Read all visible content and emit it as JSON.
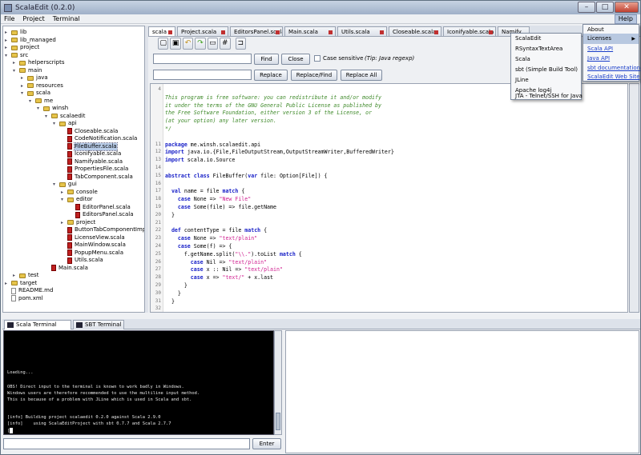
{
  "window": {
    "title": "ScalaEdit (0.2.0)"
  },
  "menubar": {
    "file": "File",
    "project": "Project",
    "terminal": "Terminal",
    "help": "Help"
  },
  "tree": [
    {
      "label": "lib",
      "kind": "folder"
    },
    {
      "label": "lib_managed",
      "kind": "folder"
    },
    {
      "label": "project",
      "kind": "folder"
    },
    {
      "label": "src",
      "kind": "folder"
    },
    {
      "label": "helperscripts",
      "kind": "folder"
    },
    {
      "label": "main",
      "kind": "folder"
    },
    {
      "label": "java",
      "kind": "folder"
    },
    {
      "label": "resources",
      "kind": "folder"
    },
    {
      "label": "scala",
      "kind": "folder"
    },
    {
      "label": "me",
      "kind": "folder"
    },
    {
      "label": "winsh",
      "kind": "folder"
    },
    {
      "label": "scalaedit",
      "kind": "folder"
    },
    {
      "label": "api",
      "kind": "folder"
    },
    {
      "label": "Closeable.scala",
      "kind": "scala"
    },
    {
      "label": "CodeNotification.scala",
      "kind": "scala"
    },
    {
      "label": "FileBuffer.scala",
      "kind": "scala"
    },
    {
      "label": "Iconifyable.scala",
      "kind": "scala"
    },
    {
      "label": "Namifyable.scala",
      "kind": "scala"
    },
    {
      "label": "PropertiesFile.scala",
      "kind": "scala"
    },
    {
      "label": "TabComponent.scala",
      "kind": "scala"
    },
    {
      "label": "gui",
      "kind": "folder"
    },
    {
      "label": "console",
      "kind": "folder"
    },
    {
      "label": "editor",
      "kind": "folder"
    },
    {
      "label": "EditorPanel.scala",
      "kind": "scala"
    },
    {
      "label": "EditorsPanel.scala",
      "kind": "scala"
    },
    {
      "label": "project",
      "kind": "folder"
    },
    {
      "label": "ButtonTabComponentImp",
      "kind": "scala"
    },
    {
      "label": "LicenseView.scala",
      "kind": "scala"
    },
    {
      "label": "MainWindow.scala",
      "kind": "scala"
    },
    {
      "label": "PopupMenu.scala",
      "kind": "scala"
    },
    {
      "label": "Utils.scala",
      "kind": "scala"
    },
    {
      "label": "Main.scala",
      "kind": "scala"
    },
    {
      "label": "test",
      "kind": "folder"
    },
    {
      "label": "target",
      "kind": "folder"
    },
    {
      "label": "README.md",
      "kind": "file"
    },
    {
      "label": "pom.xml",
      "kind": "file"
    }
  ],
  "tabs": [
    "scala",
    "Project.scala",
    "EditorsPanel.scala",
    "Main.scala",
    "Utils.scala",
    "Closeable.scala",
    "Iconifyable.scala",
    "Namify"
  ],
  "toolbar": {
    "sym_hash": "#",
    "sym_bracket": "⊐"
  },
  "find": {
    "find_label": "Find",
    "close_label": "Close",
    "case_label": "Case sensitive",
    "tip": "(Tip: Java regexp)",
    "replace_label": "Replace",
    "replace_find_label": "Replace/Find",
    "replace_all_label": "Replace All"
  },
  "editor": {
    "lines": [
      {
        "n": "4",
        "t": ""
      },
      {
        "n": "",
        "t": "This program is free software: you can redistribute it and/or modify"
      },
      {
        "n": "",
        "t": "it under the terms of the GNU General Public License as published by"
      },
      {
        "n": "",
        "t": "the Free Software Foundation, either version 3 of the License, or"
      },
      {
        "n": "",
        "t": "(at your option) any later version."
      },
      {
        "n": "",
        "t": "*/"
      },
      {
        "n": "",
        "t": ""
      },
      {
        "n": "11",
        "t": "package me.winsh.scalaedit.api"
      },
      {
        "n": "12",
        "t": "import java.io.{File,FileOutputStream,OutputStreamWriter,BufferedWriter}"
      },
      {
        "n": "13",
        "t": "import scala.io.Source"
      },
      {
        "n": "14",
        "t": ""
      },
      {
        "n": "15",
        "t": "abstract class FileBuffer(var file: Option[File]) {"
      },
      {
        "n": "16",
        "t": ""
      },
      {
        "n": "17",
        "t": "  val name = file match {"
      },
      {
        "n": "18",
        "t": "    case None => \"New File\""
      },
      {
        "n": "19",
        "t": "    case Some(file) => file.getName"
      },
      {
        "n": "20",
        "t": "  }"
      },
      {
        "n": "21",
        "t": ""
      },
      {
        "n": "22",
        "t": "  def contentType = file match {"
      },
      {
        "n": "23",
        "t": "    case None => \"text/plain\""
      },
      {
        "n": "24",
        "t": "    case Some(f) => {"
      },
      {
        "n": "25",
        "t": "      f.getName.split(\"\\\\.\").toList match {"
      },
      {
        "n": "26",
        "t": "        case Nil => \"text/plain\""
      },
      {
        "n": "27",
        "t": "        case x :: Nil => \"text/plain\""
      },
      {
        "n": "28",
        "t": "        case x => \"text/\" + x.last"
      },
      {
        "n": "29",
        "t": "      }"
      },
      {
        "n": "30",
        "t": "    }"
      },
      {
        "n": "31",
        "t": "  }"
      },
      {
        "n": "32",
        "t": ""
      }
    ]
  },
  "bottom_tabs": [
    "Scala Terminal",
    "SBT Terminal"
  ],
  "terminal": {
    "lines": [
      "Loading...",
      "",
      "OBS! Direct input to the terminal is known to work badly in Windows.",
      "Windows users are therefore recommended to use the multiline input method.",
      "This is because of a problem with JLine which is used in Scala and sbt.",
      "",
      "[info] Building project scalaedit 0.2.0 against Scala 2.9.0",
      "[info]    using ScalaEditProject with sbt 0.7.7 and Scala 2.7.7"
    ],
    "prompt": "[",
    "enter_label": "Enter"
  },
  "help_menu": {
    "about": "About",
    "licenses": "Licenses",
    "scala_api": "Scala API",
    "java_api": "Java API",
    "sbt_doc": "sbt documentation",
    "web_site": "ScalaEdit Web Site"
  },
  "licenses_menu": [
    "ScalaEdit",
    "RSyntaxTextArea",
    "Scala",
    "sbt (Simple Build Tool)",
    "JLine",
    "Apache log4j",
    "JTA - Telnet/SSH for Java"
  ]
}
